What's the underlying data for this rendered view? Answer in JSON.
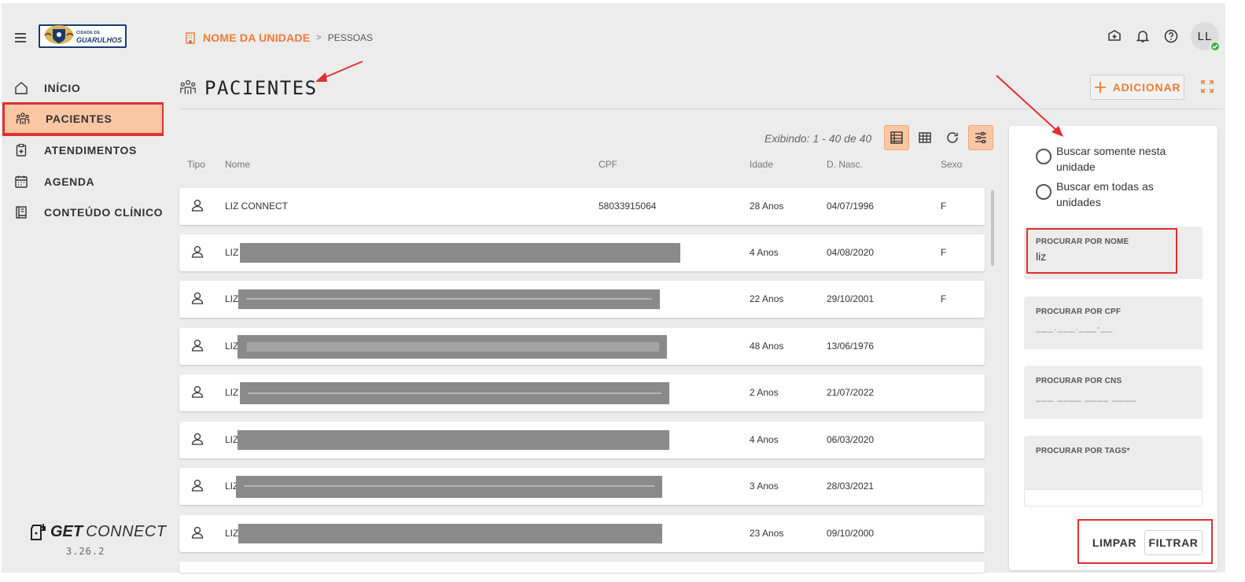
{
  "header": {
    "logo_small_text": "CIDADE DE",
    "logo_name": "GUARULHOS",
    "breadcrumb_unit": "NOME DA UNIDADE",
    "breadcrumb_separator": ">",
    "breadcrumb_current": "PESSOAS",
    "user_initials": "LL"
  },
  "sidebar": {
    "items": [
      {
        "label": "INÍCIO",
        "icon": "home-icon"
      },
      {
        "label": "PACIENTES",
        "icon": "patients-icon",
        "active": true
      },
      {
        "label": "ATENDIMENTOS",
        "icon": "clipboard-icon"
      },
      {
        "label": "AGENDA",
        "icon": "calendar-icon"
      },
      {
        "label": "CONTEÚDO CLÍNICO",
        "icon": "book-icon"
      }
    ],
    "brand_bold": "GET",
    "brand_light": "CONNECT",
    "version": "3.26.2"
  },
  "page": {
    "title": "PACIENTES",
    "add_label": "ADICIONAR",
    "showing": "Exibindo: 1 - 40 de 40"
  },
  "table": {
    "columns": [
      "Tipo",
      "Nome",
      "CPF",
      "Idade",
      "D. Nasc.",
      "Sexo"
    ],
    "rows": [
      {
        "nome": "LIZ CONNECT",
        "cpf": "58033915064",
        "idade": "28 Anos",
        "nasc": "04/07/1996",
        "sexo": "F"
      },
      {
        "nome": "LIZ",
        "cpf": "",
        "idade": "4 Anos",
        "nasc": "04/08/2020",
        "sexo": "F"
      },
      {
        "nome": "LIZ",
        "cpf": "",
        "idade": "22 Anos",
        "nasc": "29/10/2001",
        "sexo": "F"
      },
      {
        "nome": "LIZ",
        "cpf": "",
        "idade": "48 Anos",
        "nasc": "13/06/1976",
        "sexo": ""
      },
      {
        "nome": "LIZ",
        "cpf": "",
        "idade": "2 Anos",
        "nasc": "21/07/2022",
        "sexo": ""
      },
      {
        "nome": "LIZ",
        "cpf": "",
        "idade": "4 Anos",
        "nasc": "06/03/2020",
        "sexo": ""
      },
      {
        "nome": "LIZ",
        "cpf": "",
        "idade": "3 Anos",
        "nasc": "28/03/2021",
        "sexo": ""
      },
      {
        "nome": "LIZ",
        "cpf": "",
        "idade": "23 Anos",
        "nasc": "09/10/2000",
        "sexo": ""
      }
    ]
  },
  "filters": {
    "radio_unit": "Buscar somente nesta unidade",
    "radio_all": "Buscar em todas as unidades",
    "name_label": "PROCURAR POR NOME",
    "name_value": "liz",
    "cpf_label": "PROCURAR POR CPF",
    "cpf_mask": "___.___.___-__",
    "cns_label": "PROCURAR POR CNS",
    "cns_mask": "___ ____ ____ ____",
    "tags_label": "PROCURAR POR TAGS*",
    "clear_label": "LIMPAR",
    "filter_label": "FILTRAR"
  },
  "colors": {
    "accent": "#f07a32",
    "active_bg": "#fbc6a4",
    "annotation_red": "#e03030"
  }
}
